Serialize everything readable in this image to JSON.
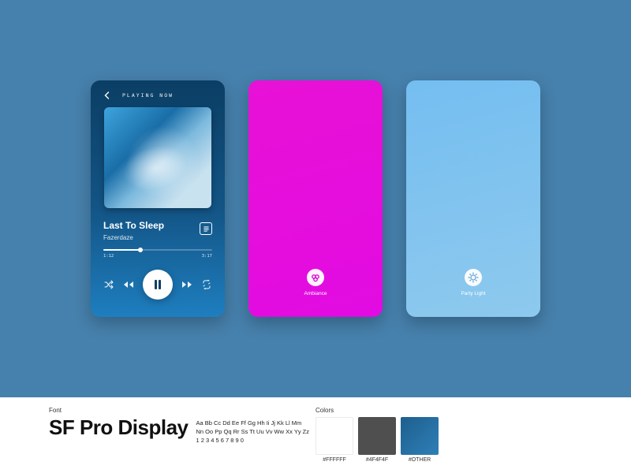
{
  "player": {
    "header_title": "PLAYING NOW",
    "track_title": "Last To Sleep",
    "track_artist": "Fazerdaze",
    "time_elapsed": "1:12",
    "time_total": "3:17",
    "progress_pct": 34
  },
  "themes": {
    "magenta": {
      "label": "Ambiance"
    },
    "light": {
      "label": "Party Light"
    }
  },
  "styleguide": {
    "font_caption": "Font",
    "font_name": "SF Pro Display",
    "specimen_line1": "Aa Bb Cc Dd Ee Ff Gg Hh Ii Jj Kk Ll Mm",
    "specimen_line2": "Nn Oo Pp Qq Rr Ss Tt Uu Vv Ww Xx Yy Zz",
    "specimen_line3": "1 2 3 4 5 6 7 8 9 0",
    "colors_caption": "Colors",
    "swatches": {
      "white": "#FFFFFF",
      "dark": "#4F4F4F",
      "other": "#OTHER"
    }
  }
}
